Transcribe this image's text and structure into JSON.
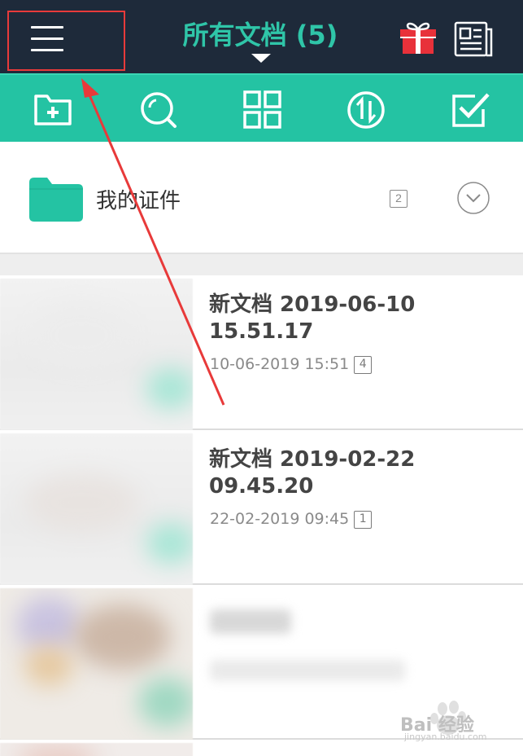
{
  "header": {
    "title": "所有文档 (5)",
    "menu_icon": "hamburger-menu-icon",
    "gift_icon": "gift-icon",
    "news_icon": "newspaper-icon",
    "accent_color": "#2fc5a8",
    "highlight_color": "#e83a3a"
  },
  "toolbar": {
    "background": "#24c3a3",
    "tools": [
      "new-folder-icon",
      "search-icon",
      "grid-view-icon",
      "sort-icon",
      "select-icon"
    ]
  },
  "folder": {
    "name": "我的证件",
    "count": "2",
    "icon": "folder-icon",
    "expand_icon": "chevron-down-icon"
  },
  "documents": [
    {
      "title_line1": "新文档 2019-06-10",
      "title_line2": "15.51.17",
      "date": "10-06-2019 15:51",
      "pages": "4"
    },
    {
      "title_line1": "新文档 2019-02-22",
      "title_line2": "09.45.20",
      "date": "22-02-2019 09:45",
      "pages": "1"
    }
  ],
  "watermark": {
    "text": "Bai 经验",
    "sub": "jingyan.baidu.com"
  }
}
